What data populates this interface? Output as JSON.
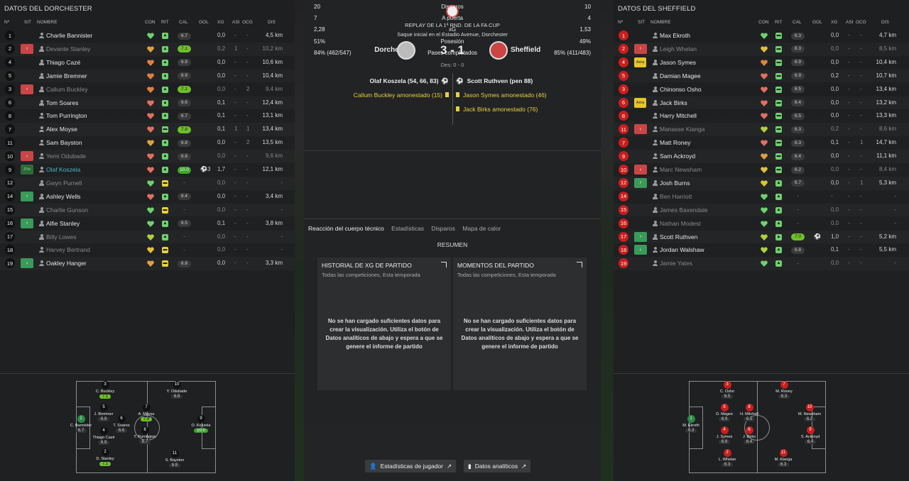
{
  "left": {
    "title": "DATOS DEL DORCHESTER",
    "headers": {
      "num": "Nº",
      "sit": "SIT",
      "name": "NOMBRE",
      "con": "CON",
      "rit": "RIT",
      "cal": "CAL",
      "gol": "GOL",
      "xg": "XG",
      "asi": "ASI",
      "ocg": "OCG",
      "dis": "DIS"
    },
    "players": [
      {
        "n": "1",
        "sit": "",
        "name": "Charlie Bannister",
        "dim": false,
        "heart": "#6fd06f",
        "rit": "#6fd06f",
        "ritc": "▲",
        "cal": "6.7",
        "calc": "",
        "gol": "",
        "xg": "0,0",
        "asi": "-",
        "ocg": "-",
        "dis": "4,5 km"
      },
      {
        "n": "2",
        "sit": "off",
        "name": "Devante Stanley",
        "dim": true,
        "heart": "#e0a040",
        "rit": "#6fd06f",
        "ritc": "▲",
        "cal": "7.1",
        "calc": "hi",
        "gol": "",
        "xg": "0,2",
        "asi": "1",
        "ocg": "-",
        "dis": "10,2 km"
      },
      {
        "n": "4",
        "sit": "",
        "name": "Thiago Cazé",
        "dim": false,
        "heart": "#e08040",
        "rit": "#6fd06f",
        "ritc": "▲",
        "cal": "6.9",
        "calc": "",
        "gol": "",
        "xg": "0,0",
        "asi": "-",
        "ocg": "-",
        "dis": "10,6 km"
      },
      {
        "n": "5",
        "sit": "",
        "name": "Jamie Bremner",
        "dim": false,
        "heart": "#e08040",
        "rit": "#6fd06f",
        "ritc": "▲",
        "cal": "6.9",
        "calc": "",
        "gol": "",
        "xg": "0,0",
        "asi": "-",
        "ocg": "-",
        "dis": "10,4 km"
      },
      {
        "n": "3",
        "sit": "off",
        "name": "Callum Buckley",
        "dim": true,
        "heart": "#e08040",
        "rit": "#6fd06f",
        "ritc": "▲",
        "cal": "7.1",
        "calc": "hi",
        "gol": "",
        "xg": "0,0",
        "asi": "-",
        "ocg": "2",
        "dis": "9,4 km"
      },
      {
        "n": "6",
        "sit": "",
        "name": "Tom Soares",
        "dim": false,
        "heart": "#e07060",
        "rit": "#6fd06f",
        "ritc": "▲",
        "cal": "6.6",
        "calc": "",
        "gol": "",
        "xg": "0,1",
        "asi": "-",
        "ocg": "-",
        "dis": "12,4 km"
      },
      {
        "n": "8",
        "sit": "",
        "name": "Tom Purrington",
        "dim": false,
        "heart": "#e07060",
        "rit": "#6fd06f",
        "ritc": "▲",
        "cal": "6.7",
        "calc": "",
        "gol": "",
        "xg": "0,1",
        "asi": "-",
        "ocg": "-",
        "dis": "13,1 km"
      },
      {
        "n": "7",
        "sit": "",
        "name": "Alex Moyse",
        "dim": false,
        "heart": "#e07060",
        "rit": "#6fd06f",
        "ritc": "▬",
        "cal": "7.8",
        "calc": "hi",
        "gol": "",
        "xg": "0,1",
        "asi": "1",
        "ocg": "1",
        "dis": "13,4 km"
      },
      {
        "n": "11",
        "sit": "",
        "name": "Sam Bayston",
        "dim": false,
        "heart": "#e0a040",
        "rit": "#6fd06f",
        "ritc": "▲",
        "cal": "6.8",
        "calc": "",
        "gol": "",
        "xg": "0,0",
        "asi": "-",
        "ocg": "2",
        "dis": "13,5 km"
      },
      {
        "n": "10",
        "sit": "off",
        "name": "Yemi Odubade",
        "dim": true,
        "heart": "#e07060",
        "rit": "#6fd06f",
        "ritc": "▲",
        "cal": "6.8",
        "calc": "",
        "gol": "",
        "xg": "0,0",
        "asi": "-",
        "ocg": "-",
        "dis": "9,6 km"
      },
      {
        "n": "9",
        "sit": "cap",
        "name": "Olaf Koszela",
        "dim": false,
        "hl": true,
        "heart": "#e07060",
        "rit": "#6fd06f",
        "ritc": "▲",
        "cal": "10.0",
        "calc": "top",
        "gol": "⚽3",
        "xg": "1,7",
        "asi": "-",
        "ocg": "-",
        "dis": "12,1 km"
      },
      {
        "n": "12",
        "sit": "",
        "name": "Gwyn Purnell",
        "dim": true,
        "heart": "#6fd06f",
        "rit": "#e6d040",
        "ritc": "▬",
        "cal": "-",
        "calc": "none",
        "gol": "",
        "xg": "0,0",
        "asi": "-",
        "ocg": "-",
        "dis": "-"
      },
      {
        "n": "14",
        "sit": "on",
        "name": "Ashley Wells",
        "dim": false,
        "heart": "#e07060",
        "rit": "#6fd06f",
        "ritc": "▲",
        "cal": "6.4",
        "calc": "",
        "gol": "",
        "xg": "0,0",
        "asi": "-",
        "ocg": "-",
        "dis": "3,4 km"
      },
      {
        "n": "15",
        "sit": "",
        "name": "Charlie Gunson",
        "dim": true,
        "heart": "#6fd06f",
        "rit": "#e6d040",
        "ritc": "▬",
        "cal": "-",
        "calc": "none",
        "gol": "",
        "xg": "0,0",
        "asi": "-",
        "ocg": "-",
        "dis": "-"
      },
      {
        "n": "16",
        "sit": "on",
        "name": "Alfie Stanley",
        "dim": false,
        "heart": "#6fd06f",
        "rit": "#6fd06f",
        "ritc": "▲",
        "cal": "6.5",
        "calc": "",
        "gol": "",
        "xg": "0,1",
        "asi": "-",
        "ocg": "-",
        "dis": "3,8 km"
      },
      {
        "n": "17",
        "sit": "",
        "name": "Billy Lowes",
        "dim": true,
        "heart": "#b0d040",
        "rit": "#6fd06f",
        "ritc": "▲",
        "cal": "-",
        "calc": "none",
        "gol": "",
        "xg": "0,0",
        "asi": "-",
        "ocg": "-",
        "dis": "-"
      },
      {
        "n": "18",
        "sit": "",
        "name": "Harvey Bertrand",
        "dim": true,
        "heart": "#e0c040",
        "rit": "#e6d040",
        "ritc": "▬",
        "cal": "-",
        "calc": "none",
        "gol": "",
        "xg": "0,0",
        "asi": "-",
        "ocg": "-",
        "dis": "-"
      },
      {
        "n": "19",
        "sit": "on",
        "name": "Oakley Hanger",
        "dim": false,
        "heart": "#e0a040",
        "rit": "#e6d040",
        "ritc": "▬",
        "cal": "6.8",
        "calc": "",
        "gol": "",
        "xg": "0,0",
        "asi": "-",
        "ocg": "-",
        "dis": "3,3 km"
      }
    ],
    "pitch": [
      {
        "n": "3",
        "name": "C. Buckley",
        "r": "7.1",
        "c": "hi"
      },
      {
        "n": "10",
        "name": "Y. Odubade",
        "r": "6.8",
        "c": ""
      },
      {
        "n": "5",
        "name": "J. Bremner",
        "r": "6.9",
        "c": ""
      },
      {
        "n": "6",
        "name": "T. Soares",
        "r": "6.6",
        "c": ""
      },
      {
        "n": "7",
        "name": "A. Moyse",
        "r": "7.8",
        "c": "hi"
      },
      {
        "n": "1",
        "name": "C. Bannister",
        "r": "6.7",
        "c": "",
        "g": true
      },
      {
        "n": "4",
        "name": "Thiago Cazé",
        "r": "6.9",
        "c": ""
      },
      {
        "n": "8",
        "name": "T. Purrington",
        "r": "6.7",
        "c": ""
      },
      {
        "n": "9",
        "name": "O. Koszela",
        "r": "10.0",
        "c": "top"
      },
      {
        "n": "2",
        "name": "D. Stanley",
        "r": "7.1",
        "c": "hi"
      },
      {
        "n": "11",
        "name": "S. Bayston",
        "r": "6.8",
        "c": ""
      }
    ]
  },
  "right": {
    "title": "DATOS DEL SHEFFIELD",
    "players": [
      {
        "n": "1",
        "sit": "",
        "name": "Max Ekroth",
        "dim": false,
        "heart": "#6fd06f",
        "rit": "#6fd06f",
        "ritc": "▬",
        "cal": "6.3",
        "calc": "",
        "gol": "",
        "xg": "0,0",
        "asi": "-",
        "ocg": "-",
        "dis": "4,7 km"
      },
      {
        "n": "2",
        "sit": "off",
        "name": "Leigh Whelan",
        "dim": true,
        "heart": "#e0c040",
        "rit": "#6fd06f",
        "ritc": "▬",
        "cal": "6.3",
        "calc": "",
        "gol": "",
        "xg": "0,0",
        "asi": "-",
        "ocg": "-",
        "dis": "8,5 km"
      },
      {
        "n": "4",
        "sit": "yel",
        "name": "Jason Symes",
        "dim": false,
        "heart": "#e08040",
        "rit": "#6fd06f",
        "ritc": "▬",
        "cal": "6.9",
        "calc": "",
        "gol": "",
        "xg": "0,0",
        "asi": "-",
        "ocg": "-",
        "dis": "10,4 km"
      },
      {
        "n": "5",
        "sit": "",
        "name": "Damian Magee",
        "dim": false,
        "heart": "#e07060",
        "rit": "#6fd06f",
        "ritc": "▬",
        "cal": "6.9",
        "calc": "",
        "gol": "",
        "xg": "0,2",
        "asi": "-",
        "ocg": "-",
        "dis": "10,7 km"
      },
      {
        "n": "3",
        "sit": "",
        "name": "Chinonso Osho",
        "dim": false,
        "heart": "#e07060",
        "rit": "#6fd06f",
        "ritc": "▬",
        "cal": "6.5",
        "calc": "",
        "gol": "",
        "xg": "0,0",
        "asi": "-",
        "ocg": "-",
        "dis": "13,4 km"
      },
      {
        "n": "6",
        "sit": "yel",
        "name": "Jack Birks",
        "dim": false,
        "heart": "#e07060",
        "rit": "#6fd06f",
        "ritc": "▬",
        "cal": "6.4",
        "calc": "",
        "gol": "",
        "xg": "0,0",
        "asi": "-",
        "ocg": "-",
        "dis": "13,2 km"
      },
      {
        "n": "8",
        "sit": "",
        "name": "Harry Mitchell",
        "dim": false,
        "heart": "#e07060",
        "rit": "#6fd06f",
        "ritc": "▬",
        "cal": "6.5",
        "calc": "",
        "gol": "",
        "xg": "0,0",
        "asi": "-",
        "ocg": "-",
        "dis": "13,3 km"
      },
      {
        "n": "11",
        "sit": "off",
        "name": "Manasse Kianga",
        "dim": true,
        "heart": "#b0d040",
        "rit": "#6fd06f",
        "ritc": "▬",
        "cal": "6.3",
        "calc": "",
        "gol": "",
        "xg": "0,2",
        "asi": "-",
        "ocg": "-",
        "dis": "8,6 km"
      },
      {
        "n": "7",
        "sit": "",
        "name": "Matt Roney",
        "dim": false,
        "heart": "#e07060",
        "rit": "#6fd06f",
        "ritc": "▬",
        "cal": "6.3",
        "calc": "",
        "gol": "",
        "xg": "0,1",
        "asi": "-",
        "ocg": "1",
        "dis": "14,7 km"
      },
      {
        "n": "9",
        "sit": "",
        "name": "Sam Ackroyd",
        "dim": false,
        "heart": "#e0a040",
        "rit": "#6fd06f",
        "ritc": "▬",
        "cal": "6.4",
        "calc": "",
        "gol": "",
        "xg": "0,0",
        "asi": "-",
        "ocg": "-",
        "dis": "11,1 km"
      },
      {
        "n": "10",
        "sit": "off",
        "name": "Marc Newsham",
        "dim": true,
        "heart": "#e0c040",
        "rit": "#6fd06f",
        "ritc": "▬",
        "cal": "6.2",
        "calc": "",
        "gol": "",
        "xg": "0,0",
        "asi": "-",
        "ocg": "-",
        "dis": "8,4 km"
      },
      {
        "n": "12",
        "sit": "on",
        "name": "Josh Burns",
        "dim": false,
        "heart": "#e0c040",
        "rit": "#6fd06f",
        "ritc": "▲",
        "cal": "6.7",
        "calc": "",
        "gol": "",
        "xg": "0,0",
        "asi": "-",
        "ocg": "1",
        "dis": "5,3 km"
      },
      {
        "n": "14",
        "sit": "",
        "name": "Ben Harriott",
        "dim": true,
        "heart": "#6fd06f",
        "rit": "#6fd06f",
        "ritc": "▲",
        "cal": "-",
        "calc": "none",
        "gol": "",
        "xg": "-",
        "asi": "-",
        "ocg": "-",
        "dis": "-"
      },
      {
        "n": "15",
        "sit": "",
        "name": "James Baxendale",
        "dim": true,
        "heart": "#6fd06f",
        "rit": "#6fd06f",
        "ritc": "▲",
        "cal": "-",
        "calc": "none",
        "gol": "",
        "xg": "0,0",
        "asi": "-",
        "ocg": "-",
        "dis": "-"
      },
      {
        "n": "16",
        "sit": "",
        "name": "Nathan Modest",
        "dim": true,
        "heart": "#6fd06f",
        "rit": "#6fd06f",
        "ritc": "▲",
        "cal": "-",
        "calc": "none",
        "gol": "",
        "xg": "0,0",
        "asi": "-",
        "ocg": "-",
        "dis": "-"
      },
      {
        "n": "17",
        "sit": "on",
        "name": "Scott Ruthven",
        "dim": false,
        "heart": "#b0d040",
        "rit": "#6fd06f",
        "ritc": "▲",
        "cal": "7.0",
        "calc": "hi",
        "gol": "⚽",
        "xg": "1,0",
        "asi": "-",
        "ocg": "-",
        "dis": "5,2 km"
      },
      {
        "n": "18",
        "sit": "on",
        "name": "Jordan Walshaw",
        "dim": false,
        "heart": "#b0d040",
        "rit": "#6fd06f",
        "ritc": "▲",
        "cal": "6.8",
        "calc": "",
        "gol": "",
        "xg": "0,1",
        "asi": "-",
        "ocg": "-",
        "dis": "5,5 km"
      },
      {
        "n": "19",
        "sit": "",
        "name": "Jamie Yates",
        "dim": true,
        "heart": "#6fd06f",
        "rit": "#6fd06f",
        "ritc": "▲",
        "cal": "-",
        "calc": "none",
        "gol": "",
        "xg": "0,0",
        "asi": "-",
        "ocg": "-",
        "dis": "-"
      }
    ],
    "pitch": [
      {
        "n": "3",
        "name": "C. Osho",
        "r": "6.5"
      },
      {
        "n": "7",
        "name": "M. Roney",
        "r": "6.3"
      },
      {
        "n": "5",
        "name": "D. Magee",
        "r": "6.9"
      },
      {
        "n": "8",
        "name": "H. Mitchell",
        "r": "6.5"
      },
      {
        "n": "10",
        "name": "M. Newsham",
        "r": "6.2"
      },
      {
        "n": "1",
        "name": "M. Ekroth",
        "r": "6.3",
        "g": true
      },
      {
        "n": "4",
        "name": "J. Symes",
        "r": "6.9"
      },
      {
        "n": "6",
        "name": "J. Birks",
        "r": "6.4"
      },
      {
        "n": "9",
        "name": "S. Ackroyd",
        "r": "6.4"
      },
      {
        "n": "2",
        "name": "L. Whelan",
        "r": "6.3"
      },
      {
        "n": "11",
        "name": "M. Kianga",
        "r": "6.3"
      }
    ]
  },
  "center": {
    "competition": "REPLAY DE LA 1ª RND. DE LA FA CUP",
    "venue": "Saque inicial en el Estadio Avenue, Dorchester",
    "home": "Dorchester",
    "away": "Sheffield",
    "score": "3 - 1",
    "ht": "Des: 0 - 0",
    "home_events": [
      {
        "text": "Olaf Koszela (54, 66, 83)",
        "type": "goal"
      },
      {
        "text": "Callum Buckley amonestado (15)",
        "type": "yellow"
      }
    ],
    "away_events": [
      {
        "text": "Scott Ruthven (pen 88)",
        "type": "goal"
      },
      {
        "text": "Jason Symes amonestado (46)",
        "type": "yellow"
      },
      {
        "text": "Jack Birks amonestado (76)",
        "type": "yellow"
      }
    ],
    "stats": [
      {
        "h": "20",
        "label": "Disparos",
        "a": "10"
      },
      {
        "h": "7",
        "label": "A puerta",
        "a": "4"
      },
      {
        "h": "2,28",
        "label": "xG",
        "a": "1,53"
      },
      {
        "h": "51%",
        "label": "Posesión",
        "a": "49%"
      },
      {
        "h": "84% (462/547)",
        "label": "Pases completados",
        "a": "85% (411/483)"
      }
    ],
    "tabs": [
      "Reacción del cuerpo técnico",
      "Estadísticas",
      "Disparos",
      "Mapa de calor"
    ],
    "summary": "RESUMEN",
    "card1": {
      "title": "HISTORIAL DE XG DE PARTIDO",
      "sub": "Todas las competiciones, Esta temporada",
      "msg": "No se han cargado suficientes datos para crear la visualización. Utiliza el botón de Datos analíticos de abajo y espera a que se genere el informe de partido"
    },
    "card2": {
      "title": "MOMENTOS DEL PARTIDO",
      "sub": "Todas las competiciones, Esta temporada",
      "msg": "No se han cargado suficientes datos para crear la visualización. Utiliza el botón de Datos analíticos de abajo y espera a que se genere el informe de partido"
    },
    "btn1": "Estadísticas de jugador",
    "btn2": "Datos analíticos"
  }
}
